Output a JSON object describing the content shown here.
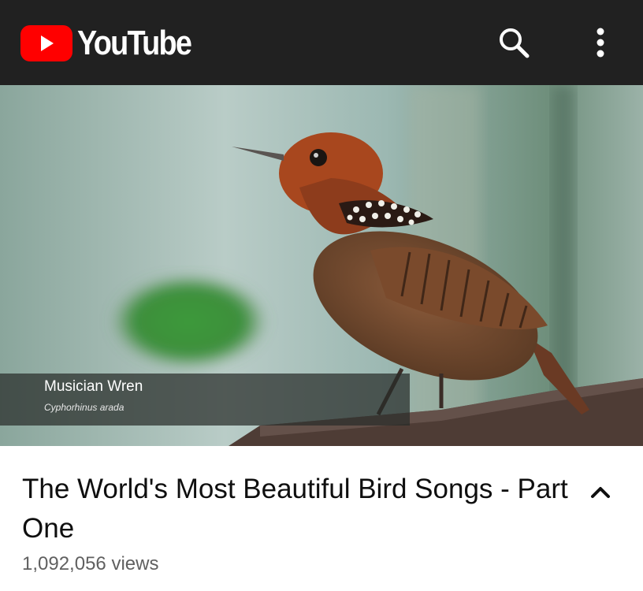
{
  "header": {
    "logo_text": "YouTube",
    "brand_color": "#FF0000",
    "bar_color": "#212121",
    "actions": [
      {
        "name": "search",
        "icon": "search-icon"
      },
      {
        "name": "more",
        "icon": "more-vert-icon"
      }
    ]
  },
  "player": {
    "caption": {
      "common_name": "Musician Wren",
      "scientific_name": "Cyphorhinus arada"
    }
  },
  "video_info": {
    "title": "The World's Most Beautiful Bird Songs - Part One",
    "views": "1,092,056 views",
    "expand_icon": "chevron-up-icon"
  }
}
